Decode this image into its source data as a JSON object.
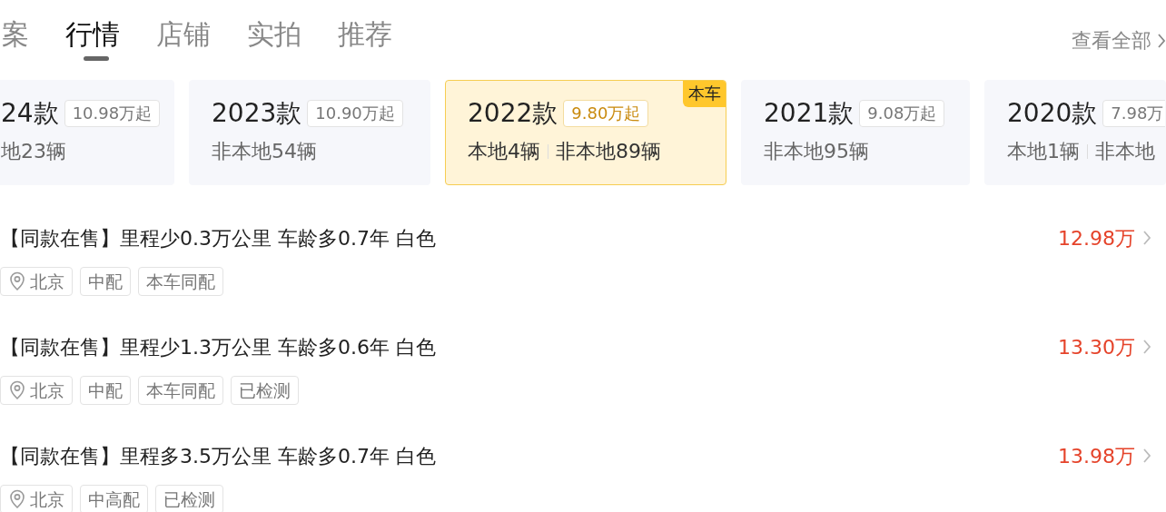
{
  "tabs": [
    {
      "label": "案",
      "selected": false
    },
    {
      "label": "行情",
      "selected": true
    },
    {
      "label": "店铺",
      "selected": false
    },
    {
      "label": "实拍",
      "selected": false
    },
    {
      "label": "推荐",
      "selected": false
    }
  ],
  "view_all": "查看全部",
  "years": [
    {
      "year": "24款",
      "price": "10.98万起",
      "counts": [
        "地23辆"
      ],
      "selected": false
    },
    {
      "year": "2023款",
      "price": "10.90万起",
      "counts": [
        "非本地54辆"
      ],
      "selected": false
    },
    {
      "year": "2022款",
      "price": "9.80万起",
      "counts": [
        "本地4辆",
        "非本地89辆"
      ],
      "selected": true,
      "badge": "本车"
    },
    {
      "year": "2021款",
      "price": "9.08万起",
      "counts": [
        "非本地95辆"
      ],
      "selected": false
    },
    {
      "year": "2020款",
      "price": "7.98万",
      "counts": [
        "本地1辆",
        "非本地"
      ],
      "selected": false
    }
  ],
  "listings": [
    {
      "title": "【同款在售】里程少0.3万公里 车龄多0.7年 白色",
      "price": "12.98万",
      "tags": [
        {
          "kind": "location",
          "text": "北京"
        },
        {
          "kind": "plain",
          "text": "中配"
        },
        {
          "kind": "plain",
          "text": "本车同配"
        }
      ]
    },
    {
      "title": "【同款在售】里程少1.3万公里 车龄多0.6年 白色",
      "price": "13.30万",
      "tags": [
        {
          "kind": "location",
          "text": "北京"
        },
        {
          "kind": "plain",
          "text": "中配"
        },
        {
          "kind": "plain",
          "text": "本车同配"
        },
        {
          "kind": "plain",
          "text": "已检测"
        }
      ]
    },
    {
      "title": "【同款在售】里程多3.5万公里 车龄多0.7年 白色",
      "price": "13.98万",
      "tags": [
        {
          "kind": "location",
          "text": "北京"
        },
        {
          "kind": "plain",
          "text": "中高配"
        },
        {
          "kind": "plain",
          "text": "已检测"
        }
      ]
    }
  ]
}
